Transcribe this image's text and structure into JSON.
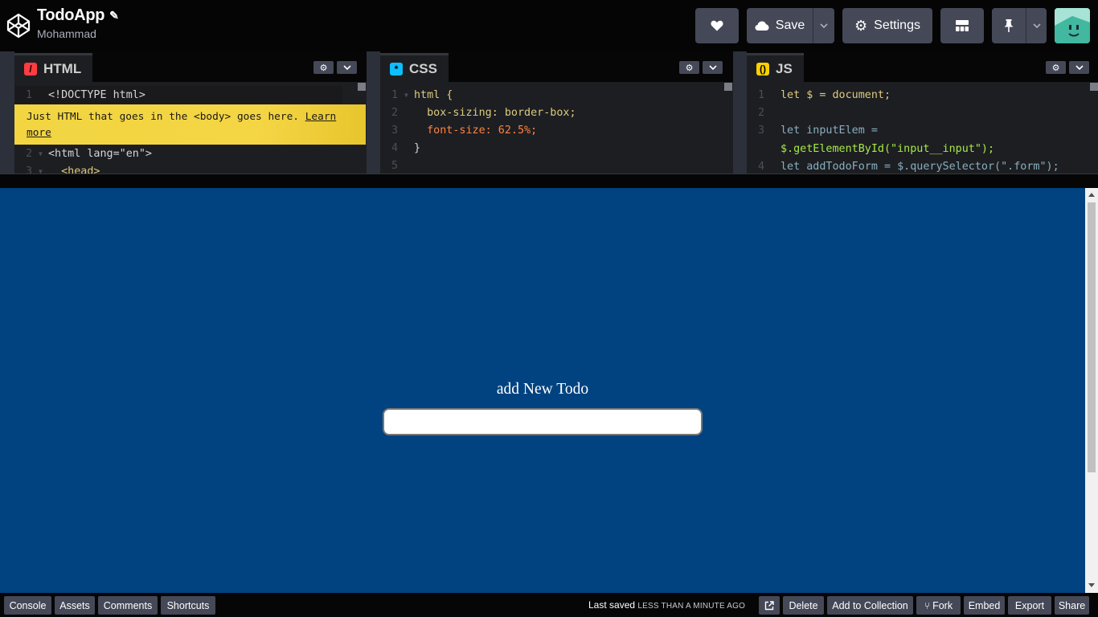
{
  "header": {
    "title": "TodoApp",
    "author": "Mohammad",
    "buttons": {
      "save": "Save",
      "settings": "Settings"
    }
  },
  "editors": {
    "html": {
      "label": "HTML",
      "hint_text": "Just HTML that goes in the <body> goes here. ",
      "hint_link": "Learn more",
      "lines": [
        {
          "n": "1",
          "text": "<!DOCTYPE html>"
        },
        {
          "n": "2",
          "text": "<html lang=\"en\">"
        },
        {
          "n": "3",
          "text": "  <head>"
        }
      ]
    },
    "css": {
      "label": "CSS",
      "lines": [
        {
          "n": "1",
          "text": "html {"
        },
        {
          "n": "2",
          "text": "  box-sizing: border-box;"
        },
        {
          "n": "3",
          "text": "  font-size: 62.5%;"
        },
        {
          "n": "4",
          "text": "}"
        },
        {
          "n": "5",
          "text": ""
        }
      ]
    },
    "js": {
      "label": "JS",
      "lines": [
        {
          "n": "1",
          "text": "let $ = document;"
        },
        {
          "n": "2",
          "text": ""
        },
        {
          "n": "3",
          "text": "let inputElem ="
        },
        {
          "n": "",
          "text": "$.getElementById(\"input__input\");"
        },
        {
          "n": "4",
          "text": "let addTodoForm = $.querySelector(\".form\");"
        }
      ]
    }
  },
  "preview": {
    "heading": "add New Todo",
    "input_value": ""
  },
  "footer": {
    "left": [
      "Console",
      "Assets",
      "Comments",
      "Shortcuts"
    ],
    "saved_label": "Last saved",
    "saved_when": "LESS THAN A MINUTE AGO",
    "right": {
      "delete": "Delete",
      "collection": "Add to Collection",
      "fork": "Fork",
      "embed": "Embed",
      "export": "Export",
      "share": "Share"
    }
  },
  "colors": {
    "preview_bg": "#004380",
    "hint_bg": "#f2d541",
    "html_icon": "#ff3c41",
    "css_icon": "#0ebeff",
    "js_icon": "#fcd000"
  }
}
